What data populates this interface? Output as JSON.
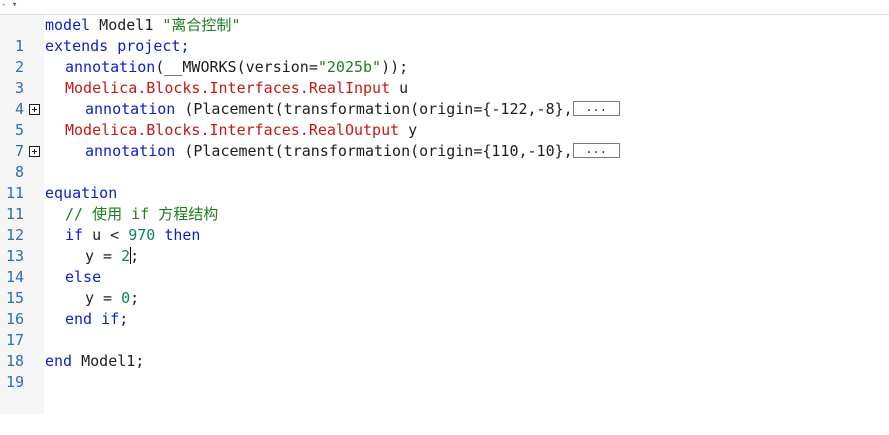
{
  "toolbar": {
    "mini_icons": "- ▾"
  },
  "lines": [
    {
      "n": "1"
    },
    {
      "n": "2"
    },
    {
      "n": "3"
    },
    {
      "n": "4"
    },
    {
      "n": "5"
    },
    {
      "n": "7"
    },
    {
      "n": "8"
    },
    {
      "n": "11"
    },
    {
      "n": "11"
    },
    {
      "n": "12"
    },
    {
      "n": "13"
    },
    {
      "n": "14"
    },
    {
      "n": "15"
    },
    {
      "n": "16"
    },
    {
      "n": "17"
    },
    {
      "n": "18"
    },
    {
      "n": "19"
    }
  ],
  "code": {
    "l1": {
      "kw": "model",
      "name": " Model1 ",
      "str": "\"离合控制\""
    },
    "l2": {
      "kw": "extends",
      "rest": " project;"
    },
    "l3": {
      "kw": "annotation",
      "rest": "(__MWORKS(version=",
      "str": "\"2025b\"",
      "end": "));"
    },
    "l4": {
      "cls": "Modelica.Blocks.Interfaces.RealInput",
      "rest": " u"
    },
    "l5": {
      "kw": "annotation",
      "rest": " (Placement(transformation(origin={-122,-8},",
      "box": "..."
    },
    "l7": {
      "cls": "Modelica.Blocks.Interfaces.RealOutput",
      "rest": " y"
    },
    "l8": {
      "kw": "annotation",
      "rest": " (Placement(transformation(origin={110,-10},",
      "box": "..."
    },
    "l11": {
      "kw": "equation"
    },
    "l12": {
      "cmt": "// 使用 if 方程结构"
    },
    "l13": {
      "kw1": "if",
      "mid": " u < ",
      "num": "970",
      "kw2": " then"
    },
    "l14": {
      "pre": "y = ",
      "num": "2",
      "post": ";"
    },
    "l15": {
      "kw": "else"
    },
    "l16": {
      "pre": "y = ",
      "num": "0",
      "post": ";"
    },
    "l17": {
      "kw": "end if",
      "post": ";"
    },
    "l19": {
      "kw": "end",
      "rest": " Model1;"
    }
  }
}
